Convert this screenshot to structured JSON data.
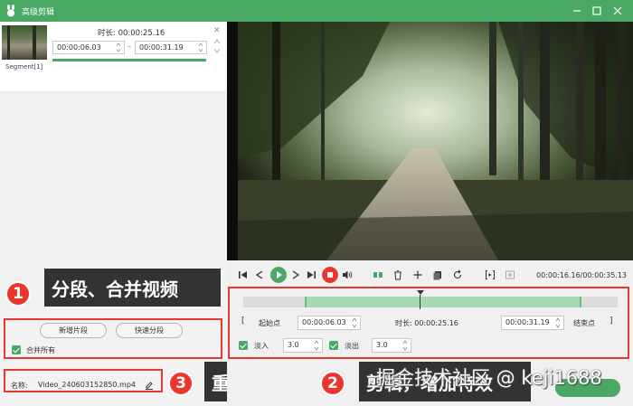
{
  "window": {
    "title": "高级剪辑"
  },
  "segment": {
    "label": "Segment[1]",
    "duration_label": "时长: 00:00:25.16",
    "start": "00:00:06.03",
    "separator": "–",
    "end": "00:00:31.19",
    "progress": 1.0
  },
  "callouts": [
    {
      "number": "1",
      "text": "分段、合并视频"
    },
    {
      "number": "2",
      "text": "剪辑，增加特效"
    },
    {
      "number": "3",
      "text": "重命名"
    }
  ],
  "left_actions": {
    "new_segment": "新增片段",
    "quick_split": "快速分段",
    "merge_all": "合并所有"
  },
  "file": {
    "name_label": "名称:",
    "name_value": "Video_240603152850.mp4"
  },
  "player": {
    "timecode": "00:00:16.16/00:00:35.13"
  },
  "trim": {
    "start_btn": "起始点",
    "start_value": "00:00:06.03",
    "duration_label": "时长: 00:00:25.16",
    "end_value": "00:00:31.19",
    "end_btn": "结束点"
  },
  "effects": {
    "fade_in_label": "淡入",
    "fade_in_value": "3.0",
    "fade_out_label": "淡出",
    "fade_out_value": "3.0"
  },
  "watermark": "掘金技术社区 @ keji1688",
  "colors": {
    "accent": "#49a863",
    "callout_bg": "#333333",
    "badge": "#e9362e"
  },
  "icons": [
    "app-logo-icon",
    "minimize-icon",
    "maximize-icon",
    "close-icon",
    "skip-start-icon",
    "step-back-icon",
    "play-icon",
    "step-forward-icon",
    "skip-end-icon",
    "stop-icon",
    "volume-icon",
    "split-icon",
    "delete-icon",
    "add-icon",
    "copy-icon",
    "reset-icon",
    "bracket-in-icon",
    "snapshot-icon",
    "edit-icon"
  ]
}
